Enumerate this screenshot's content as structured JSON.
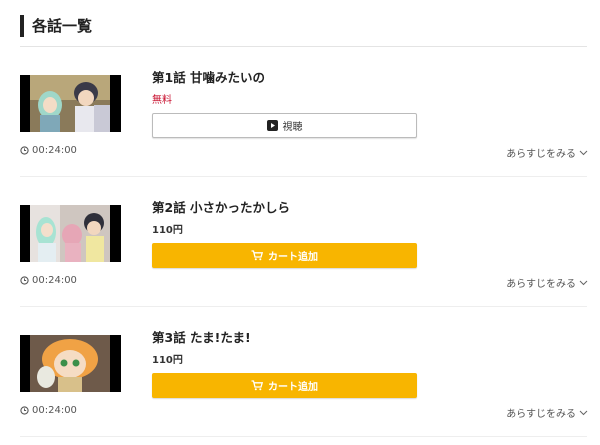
{
  "section": {
    "title": "各話一覧"
  },
  "episodes": [
    {
      "title": "第1話 甘噛みたいの",
      "price": "無料",
      "button_label": "視聴",
      "button_type": "watch",
      "duration": "00:24:00",
      "synopsis_label": "あらすじをみる"
    },
    {
      "title": "第2話 小さかったかしら",
      "price": "110円",
      "button_label": "カート追加",
      "button_type": "cart",
      "duration": "00:24:00",
      "synopsis_label": "あらすじをみる"
    },
    {
      "title": "第3話 たま!たま!",
      "price": "110円",
      "button_label": "カート追加",
      "button_type": "cart",
      "duration": "00:24:00",
      "synopsis_label": "あらすじをみる"
    }
  ],
  "colors": {
    "accent": "#f8b500",
    "free": "#c8102e",
    "text": "#333333"
  },
  "icons": {
    "watch": "play-icon",
    "cart": "cart-icon",
    "duration": "clock-icon",
    "expand": "chevron-down-icon"
  }
}
